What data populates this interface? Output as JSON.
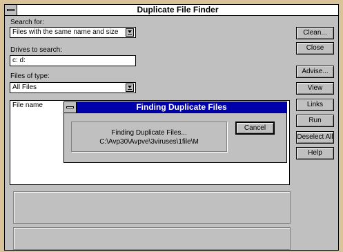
{
  "window": {
    "title": "Duplicate File Finder"
  },
  "search_for": {
    "label": "Search for:",
    "value": "Files with the same name and size"
  },
  "drives": {
    "label": "Drives to search:",
    "value": "c: d:"
  },
  "file_types": {
    "label": "Files of type:",
    "value": "All Files"
  },
  "list": {
    "column_header": "File name"
  },
  "buttons": {
    "clean": "Clean...",
    "close": "Close",
    "advise": "Advise...",
    "view": "View",
    "links": "Links",
    "run": "Run",
    "deselect_all": "Deselect All",
    "help": "Help"
  },
  "dialog": {
    "title": "Finding Duplicate Files",
    "message_line1": "Finding Duplicate Files...",
    "message_line2": "C:\\Avp30\\Avpve\\3viruses\\1file\\M",
    "cancel": "Cancel"
  },
  "colors": {
    "dialog_title_bg": "#0000aa",
    "face": "#c0c0c0",
    "desktop": "#d9c49a"
  }
}
